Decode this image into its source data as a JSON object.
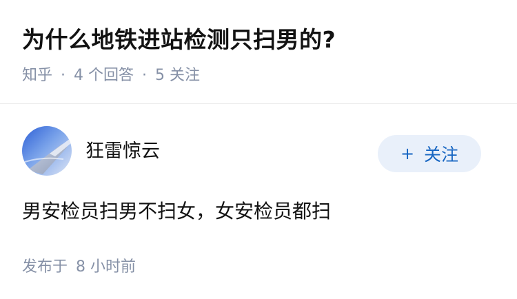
{
  "question": {
    "title": "为什么地铁进站检测只扫男的?",
    "source": "知乎",
    "answer_count": "4",
    "answer_label": "个回答",
    "follower_count": "5",
    "follower_label": "关注"
  },
  "answer": {
    "author_name": "狂雷惊云",
    "follow_button_label": "关注",
    "follow_icon": "plus-icon",
    "content": "男安检员扫男不扫女，女安检员都扫",
    "published_prefix": "发布于",
    "published_time": "8 小时前"
  },
  "colors": {
    "title": "#121212",
    "meta": "#8590a6",
    "follow_button_bg": "#e9f0fa",
    "follow_button_text": "#1766c2",
    "divider": "#ebebeb"
  }
}
